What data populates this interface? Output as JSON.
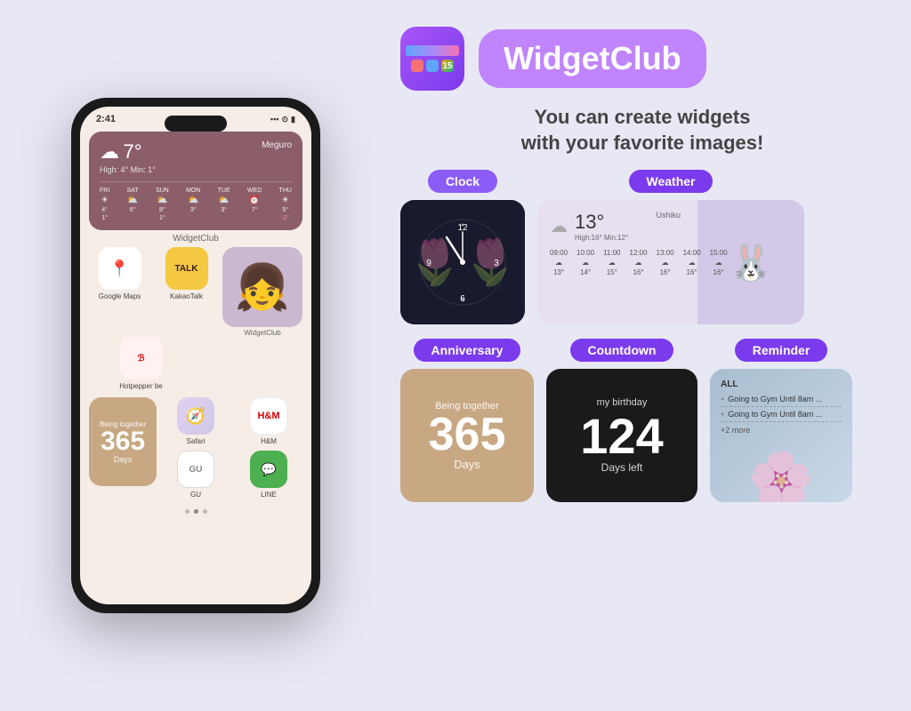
{
  "page": {
    "background_color": "#e8e8f5"
  },
  "phone": {
    "time": "2:41",
    "status": {
      "signal": "▪▪▪",
      "wifi": "wifi",
      "battery": "🔋"
    },
    "weather_widget": {
      "temperature": "7°",
      "location": "Meguro",
      "high_low": "High: 4°  Min: 1°",
      "days": [
        {
          "day": "FRI",
          "icon": "☀️",
          "high": "4°",
          "low": "1°"
        },
        {
          "day": "SAT",
          "icon": "⛅",
          "high": "6°",
          "low": ""
        },
        {
          "day": "SUN",
          "icon": "⛅",
          "high": "8°",
          "low": "1°"
        },
        {
          "day": "MON",
          "icon": "⛅",
          "high": "3°",
          "low": ""
        },
        {
          "day": "TUE",
          "icon": "⛅",
          "high": "3°",
          "low": ""
        },
        {
          "day": "WED",
          "icon": "⏰",
          "high": "7°",
          "low": ""
        },
        {
          "day": "THU",
          "icon": "☀️",
          "high": "5°",
          "low": "-2°"
        }
      ]
    },
    "widget_label": "WidgetClub",
    "apps": {
      "google_maps": "Google Maps",
      "kakao_talk": "KakaoTalk",
      "hotpepper": "Hotpepper be",
      "widgetclub": "WidgetClub",
      "safari": "Safari",
      "hm": "H&M",
      "gu": "GU",
      "line": "LINE"
    },
    "anniversary": {
      "label": "Being together",
      "number": "365",
      "unit": "Days"
    },
    "dots": [
      1,
      2,
      3
    ]
  },
  "right": {
    "app_name": "WidgetClub",
    "tagline_line1": "You can create widgets",
    "tagline_line2": "with your favorite images!",
    "sections": {
      "clock": {
        "badge": "Clock",
        "numbers": [
          "12",
          "3",
          "6",
          "9"
        ]
      },
      "weather": {
        "badge": "Weather",
        "location": "Ushiku",
        "temperature": "13°",
        "high_low": "High:16° Min:12°",
        "hours": [
          "09:00",
          "10:00",
          "11:00",
          "12:00",
          "13:00",
          "14:00",
          "15:00"
        ],
        "temps": [
          "13°",
          "14°",
          "15°",
          "16°",
          "16°",
          "16°",
          "16°"
        ]
      },
      "anniversary": {
        "badge": "Anniversary",
        "label": "Being together",
        "number": "365",
        "unit": "Days"
      },
      "countdown": {
        "badge": "Countdown",
        "title": "my birthday",
        "number": "124",
        "unit": "Days left"
      },
      "reminder": {
        "badge": "Reminder",
        "items": [
          "ALL",
          "Going to Gym Until 8am ...",
          "Going to Gym Until 8am ...",
          "+2 more"
        ]
      }
    }
  }
}
